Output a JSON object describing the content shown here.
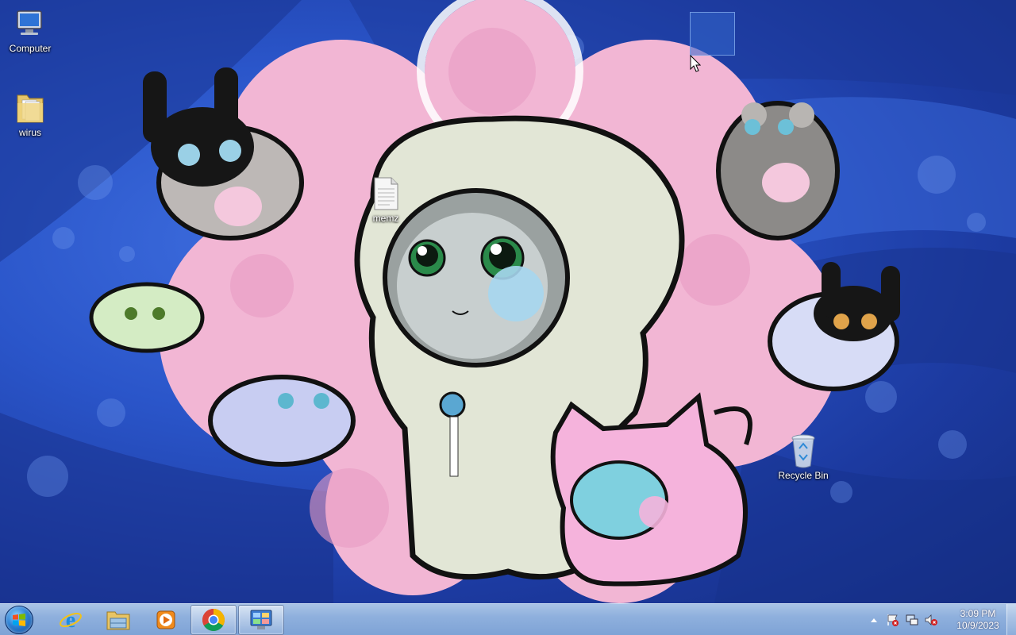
{
  "desktop": {
    "icons": [
      {
        "label": "Computer",
        "icon": "computer-icon"
      },
      {
        "label": "wirus",
        "icon": "folder-icon"
      },
      {
        "label": "memz",
        "icon": "text-file-icon"
      },
      {
        "label": "Recycle Bin",
        "icon": "recycle-bin-icon"
      }
    ]
  },
  "taskbar": {
    "start": {
      "icon": "windows-logo-icon"
    },
    "pinned": [
      {
        "name": "internet-explorer",
        "icon": "internet-explorer-icon",
        "active": false
      },
      {
        "name": "windows-explorer",
        "icon": "folder-library-icon",
        "active": false
      },
      {
        "name": "media-player",
        "icon": "media-player-icon",
        "active": false
      },
      {
        "name": "google-chrome",
        "icon": "chrome-icon",
        "active": true
      },
      {
        "name": "control-panel",
        "icon": "control-panel-icon",
        "active": true
      }
    ],
    "tray": {
      "icons": [
        "show-hidden-icons-arrow-icon",
        "action-center-flag-icon",
        "network-icon",
        "volume-muted-icon"
      ],
      "time": "3:09 PM",
      "date": "10/9/2023"
    }
  },
  "colors": {
    "wallpaper_blue": "#2a55c9",
    "wallpaper_pink": "#f2b6d4",
    "taskbar": "#8fb0dd"
  }
}
